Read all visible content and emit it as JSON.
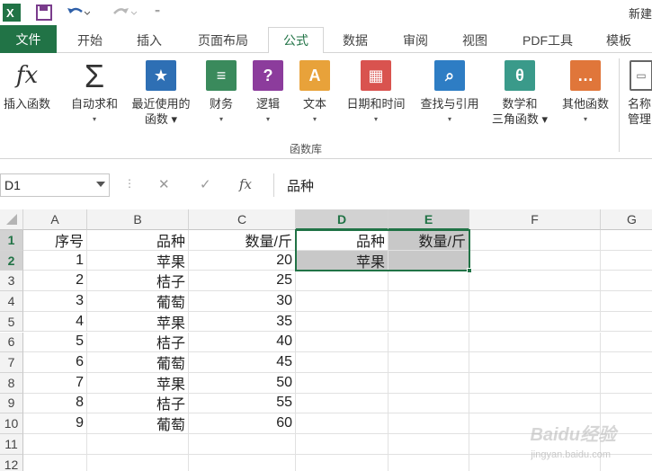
{
  "titlebar": {
    "doc_title": "新建",
    "icons": [
      "excel-logo-icon",
      "save-icon",
      "undo-icon",
      "redo-icon",
      "customize-qat-icon"
    ]
  },
  "tabs": [
    "文件",
    "开始",
    "插入",
    "页面布局",
    "公式",
    "数据",
    "审阅",
    "视图",
    "PDF工具",
    "模板"
  ],
  "active_tab": "公式",
  "ribbon": {
    "buttons": [
      {
        "label1": "插入函数",
        "label2": "",
        "icon": "fx-icon",
        "color": "#333333",
        "caret": false
      },
      {
        "label1": "自动求和",
        "label2": "▾",
        "icon": "sigma-icon",
        "color": "#333333",
        "caret": true
      },
      {
        "label1": "最近使用的",
        "label2": "函数 ▾",
        "icon": "star-book-icon",
        "color": "#2e6fb4",
        "caret": false
      },
      {
        "label1": "财务",
        "label2": "▾",
        "icon": "finance-book-icon",
        "color": "#3a8a5c",
        "caret": true
      },
      {
        "label1": "逻辑",
        "label2": "▾",
        "icon": "question-book-icon",
        "color": "#8c3c9c",
        "caret": true
      },
      {
        "label1": "文本",
        "label2": "▾",
        "icon": "text-book-icon",
        "color": "#e8a23a",
        "caret": true
      },
      {
        "label1": "日期和时间",
        "label2": "▾",
        "icon": "calendar-book-icon",
        "color": "#d9534f",
        "caret": true
      },
      {
        "label1": "查找与引用",
        "label2": "▾",
        "icon": "lookup-book-icon",
        "color": "#2e7dc4",
        "caret": true
      },
      {
        "label1": "数学和",
        "label2": "三角函数 ▾",
        "icon": "theta-book-icon",
        "color": "#3a9a8a",
        "caret": false
      },
      {
        "label1": "其他函数",
        "label2": "▾",
        "icon": "more-book-icon",
        "color": "#e0763a",
        "caret": true
      },
      {
        "label1": "名称",
        "label2": "管理",
        "icon": "name-manager-icon",
        "color": "#666666",
        "caret": false
      }
    ],
    "group_label": "函数库"
  },
  "formula_bar": {
    "name_box": "D1",
    "cancel_icon": "✕",
    "enter_icon": "✓",
    "fx_label": "fx",
    "content": "品种"
  },
  "sheet": {
    "columns": [
      "A",
      "B",
      "C",
      "D",
      "E",
      "F",
      "G"
    ],
    "selected_columns": [
      "D",
      "E"
    ],
    "rows": [
      {
        "n": "1",
        "A": "序号",
        "B": "品种",
        "C": "数量/斤",
        "D": "品种",
        "E": "数量/斤"
      },
      {
        "n": "2",
        "A": "1",
        "B": "苹果",
        "C": "20",
        "D": "苹果",
        "E": ""
      },
      {
        "n": "3",
        "A": "2",
        "B": "桔子",
        "C": "25",
        "D": "",
        "E": ""
      },
      {
        "n": "4",
        "A": "3",
        "B": "葡萄",
        "C": "30",
        "D": "",
        "E": ""
      },
      {
        "n": "5",
        "A": "4",
        "B": "苹果",
        "C": "35",
        "D": "",
        "E": ""
      },
      {
        "n": "6",
        "A": "5",
        "B": "桔子",
        "C": "40",
        "D": "",
        "E": ""
      },
      {
        "n": "7",
        "A": "6",
        "B": "葡萄",
        "C": "45",
        "D": "",
        "E": ""
      },
      {
        "n": "8",
        "A": "7",
        "B": "苹果",
        "C": "50",
        "D": "",
        "E": ""
      },
      {
        "n": "9",
        "A": "8",
        "B": "桔子",
        "C": "55",
        "D": "",
        "E": ""
      },
      {
        "n": "10",
        "A": "9",
        "B": "葡萄",
        "C": "60",
        "D": "",
        "E": ""
      },
      {
        "n": "11",
        "A": "",
        "B": "",
        "C": "",
        "D": "",
        "E": ""
      },
      {
        "n": "12",
        "A": "",
        "B": "",
        "C": "",
        "D": "",
        "E": ""
      }
    ],
    "selected_rows": [
      "1",
      "2"
    ]
  },
  "watermark": {
    "line1": "Baidu经验",
    "line2": "jingyan.baidu.com"
  },
  "colors": {
    "accent": "#217346",
    "selection_fill": "#c8c8c8"
  }
}
